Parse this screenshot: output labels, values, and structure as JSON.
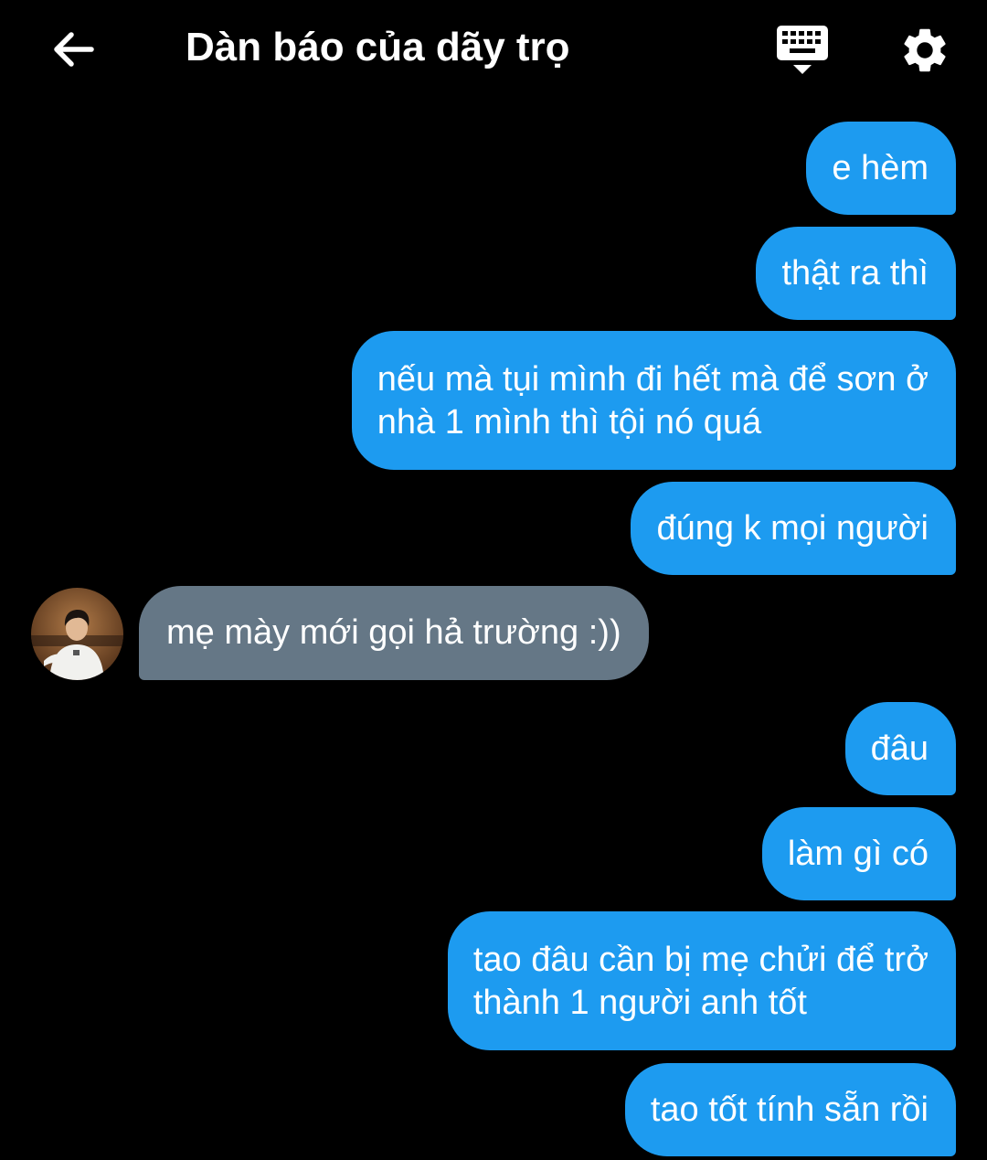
{
  "header": {
    "title": "Dàn báo của dãy trọ",
    "back_icon": "arrow-left-icon",
    "keyboard_icon": "keyboard-icon",
    "settings_icon": "gear-icon"
  },
  "messages": [
    {
      "direction": "out",
      "text": "e hèm"
    },
    {
      "direction": "out",
      "text": "thật ra thì"
    },
    {
      "direction": "out",
      "lines": [
        "nếu mà tụi mình đi hết mà để sơn ở",
        "nhà 1 mình thì tội nó quá"
      ]
    },
    {
      "direction": "out",
      "text": "đúng k mọi người"
    },
    {
      "direction": "in",
      "text": "mẹ mày mới gọi hả trường :))"
    },
    {
      "direction": "out",
      "text": "đâu"
    },
    {
      "direction": "out",
      "text": "làm gì có"
    },
    {
      "direction": "out",
      "lines": [
        "tao đâu cần bị mẹ chửi để trở",
        "thành 1 người anh tốt"
      ]
    },
    {
      "direction": "out",
      "text": "tao tốt tính sẵn rồi"
    }
  ],
  "colors": {
    "background": "#000000",
    "outgoing_bubble": "#1d9bf0",
    "incoming_bubble": "#657786",
    "text": "#ffffff"
  }
}
